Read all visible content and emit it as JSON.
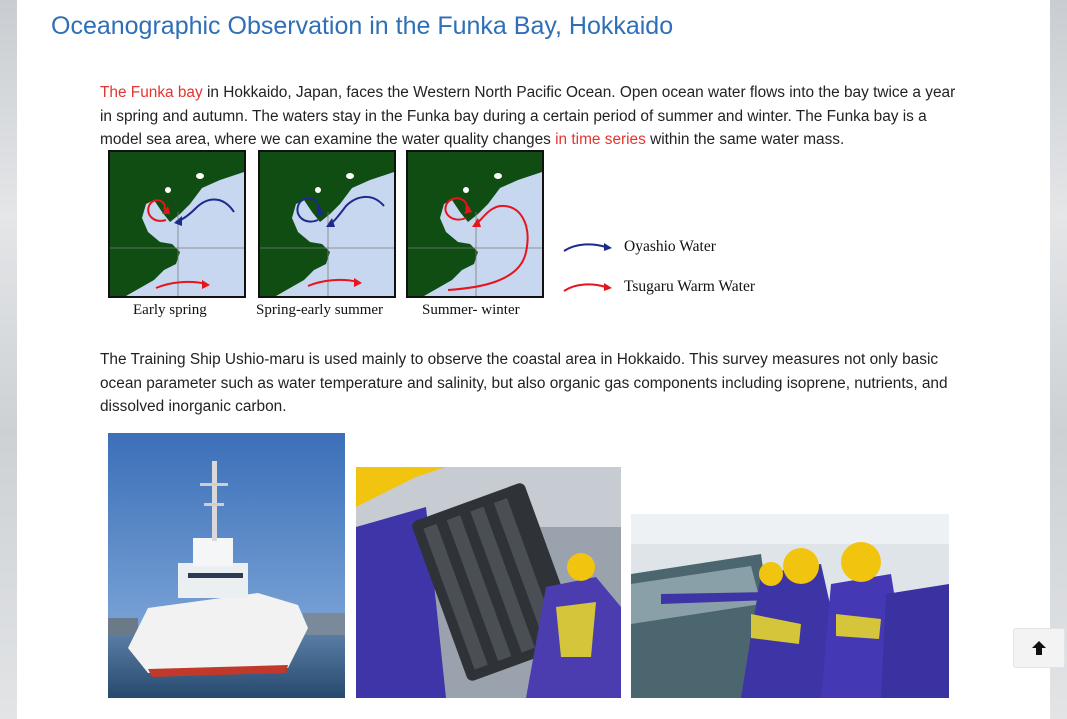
{
  "page": {
    "title": "Oceanographic Observation in the Funka Bay, Hokkaido"
  },
  "intro": {
    "highlight_start": "The Funka bay",
    "text_a": " in Hokkaido, Japan, faces the Western North Pacific Ocean. Open ocean water flows into the bay twice a year in spring and autumn. The waters stay in the Funka bay during a certain period of summer and winter. The Funka bay is a model sea area, where we can examine the water quality  changes ",
    "highlight_mid": "in time series",
    "text_b": " within the same water mass."
  },
  "figure": {
    "maps": [
      {
        "caption": "Early  spring"
      },
      {
        "caption": "Spring-early  summer"
      },
      {
        "caption": "Summer-  winter"
      }
    ],
    "legend": [
      {
        "label": "Oyashio  Water",
        "color": "#1c2a8c"
      },
      {
        "label": "Tsugaru  Warm  Water",
        "color": "#e8141c"
      }
    ],
    "land_color": "#0f4d12",
    "sea_color": "#c6d7ef"
  },
  "survey": {
    "text": "The Training Ship Ushio-maru is used mainly to observe the coastal area in Hokkaido. This survey measures not only basic ocean parameter such as water temperature and salinity, but also organic gas components including isoprene, nutrients, and dissolved inorganic carbon."
  },
  "photos": [
    {
      "icon": "training-ship-photo"
    },
    {
      "icon": "water-sampler-rosette-photo"
    },
    {
      "icon": "crew-observation-photo"
    }
  ],
  "ui": {
    "back_to_top_icon": "arrow-up-icon"
  }
}
